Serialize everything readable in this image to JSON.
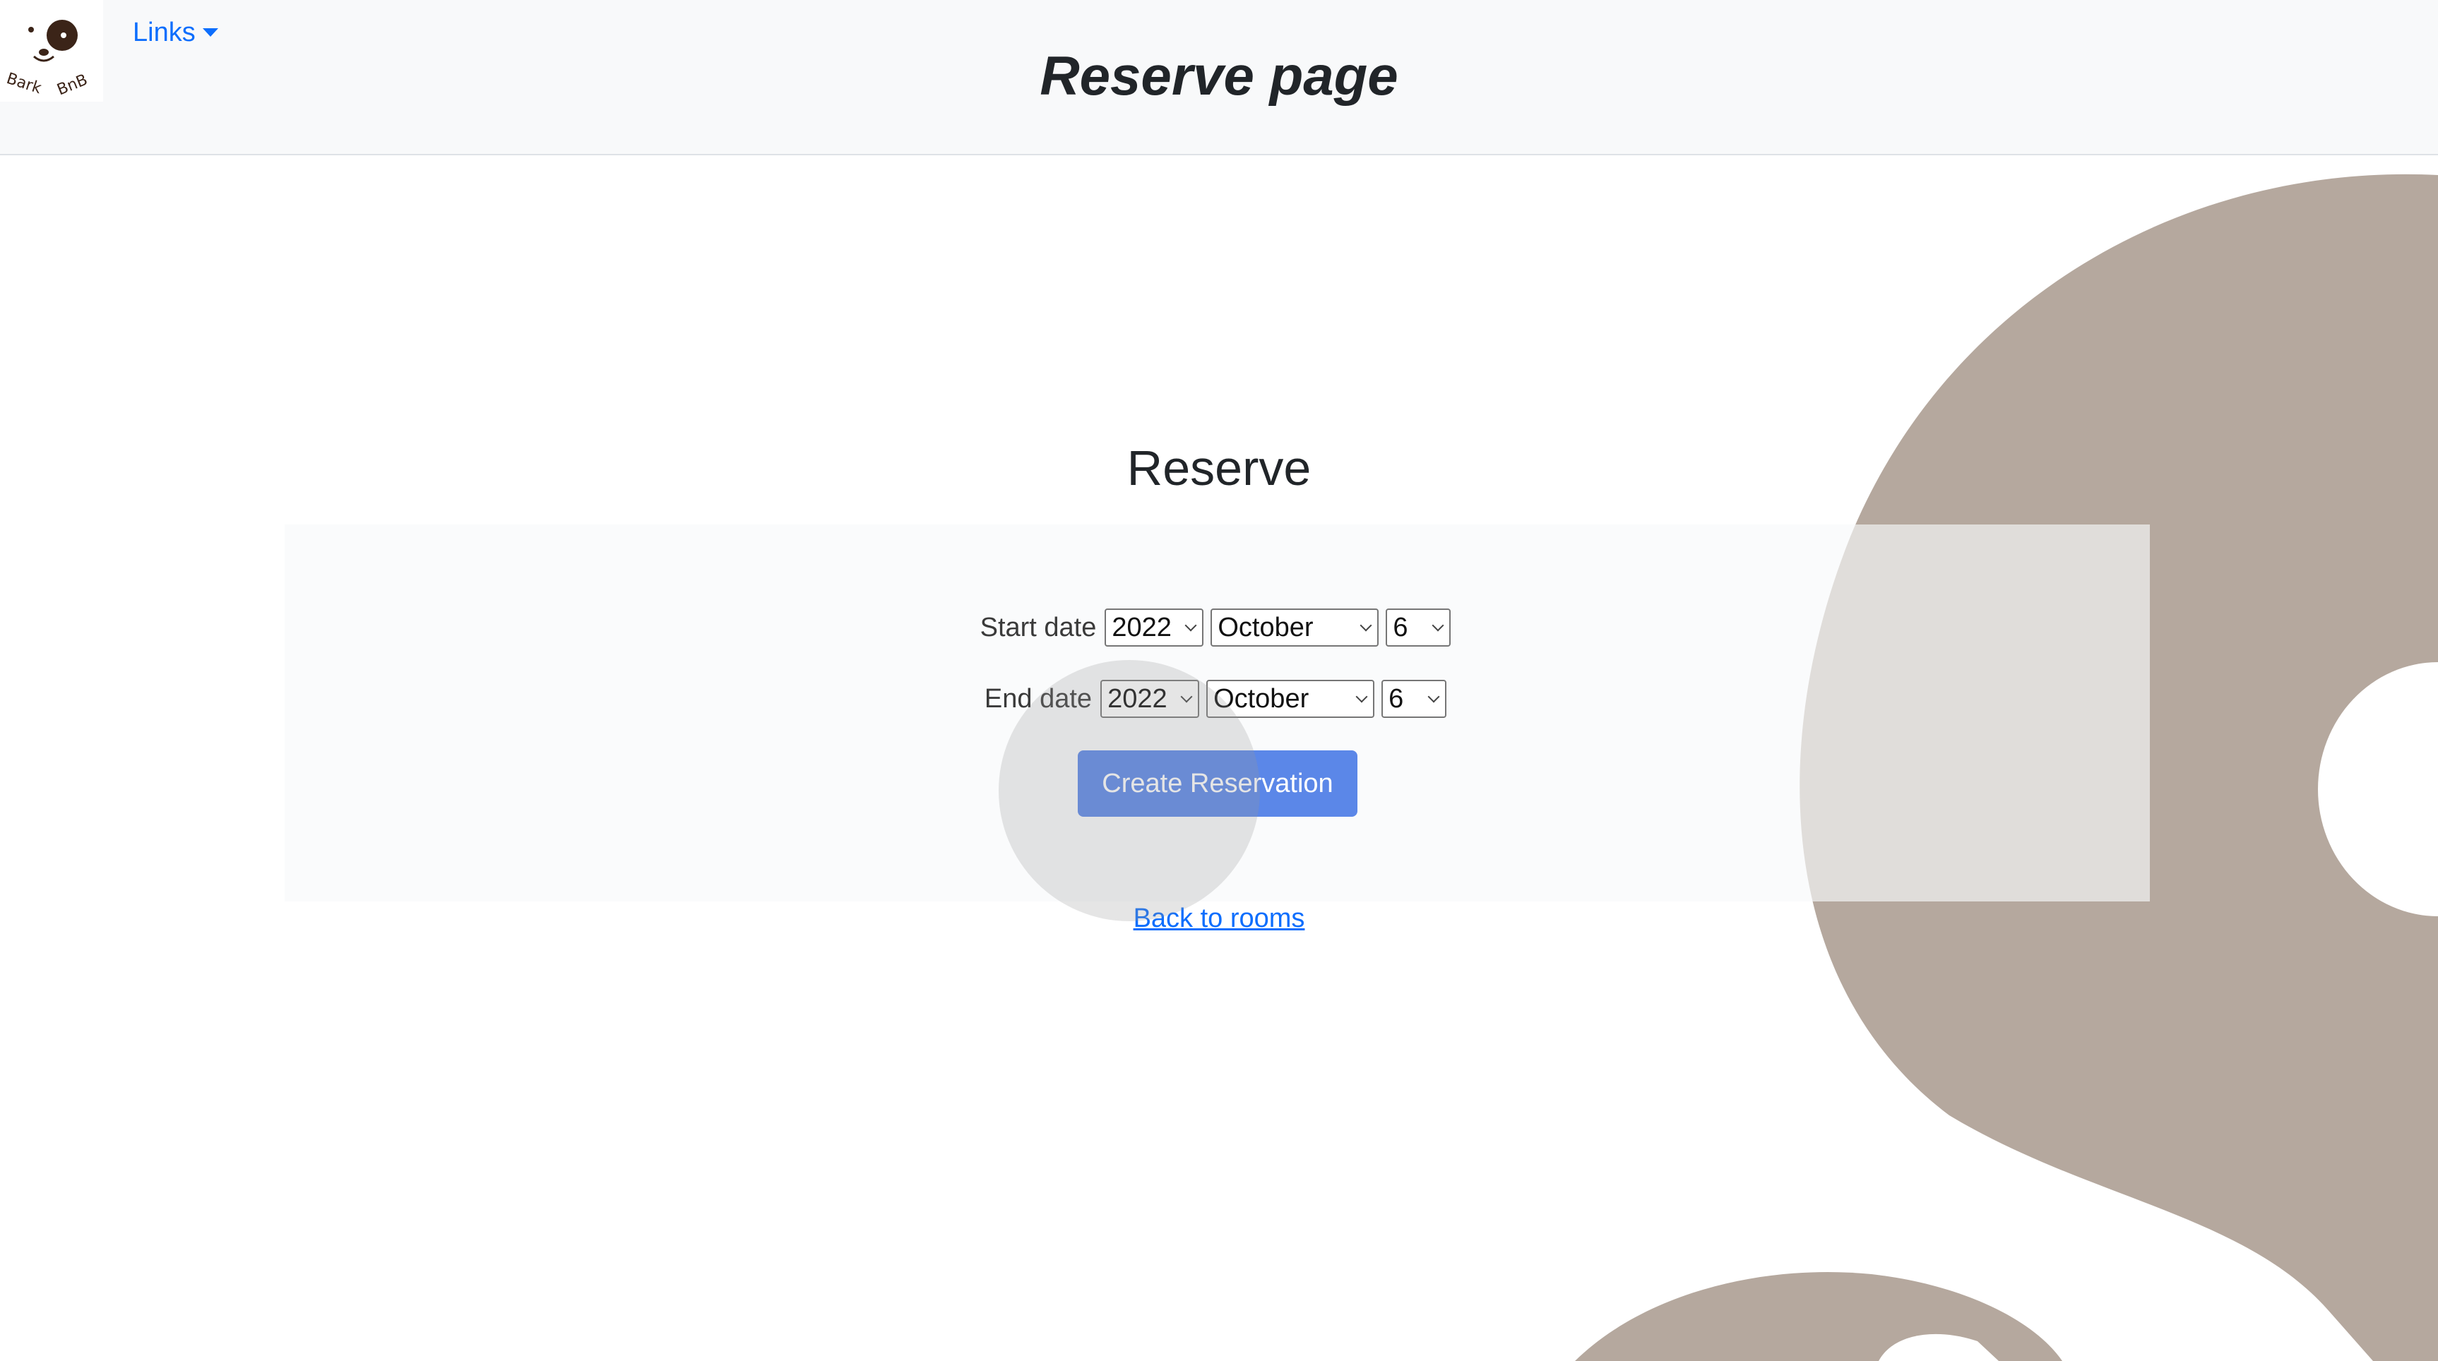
{
  "header": {
    "logo_text": "Bark BnB",
    "links_menu_label": "Links",
    "page_title": "Reserve page"
  },
  "main": {
    "heading": "Reserve",
    "start_date": {
      "label": "Start date",
      "year": "2022",
      "month": "October",
      "day": "6"
    },
    "end_date": {
      "label": "End date",
      "year": "2022",
      "month": "October",
      "day": "6"
    },
    "create_button_label": "Create Reservation",
    "back_link_label": "Back to rooms"
  },
  "colors": {
    "accent": "#0d6efd",
    "button": "#5b87e8",
    "navbar_bg": "#f8f9fa",
    "decor": "#b5a89e"
  },
  "icons": [
    "dog-logo-icon",
    "caret-down-icon",
    "chevron-down-icon"
  ]
}
